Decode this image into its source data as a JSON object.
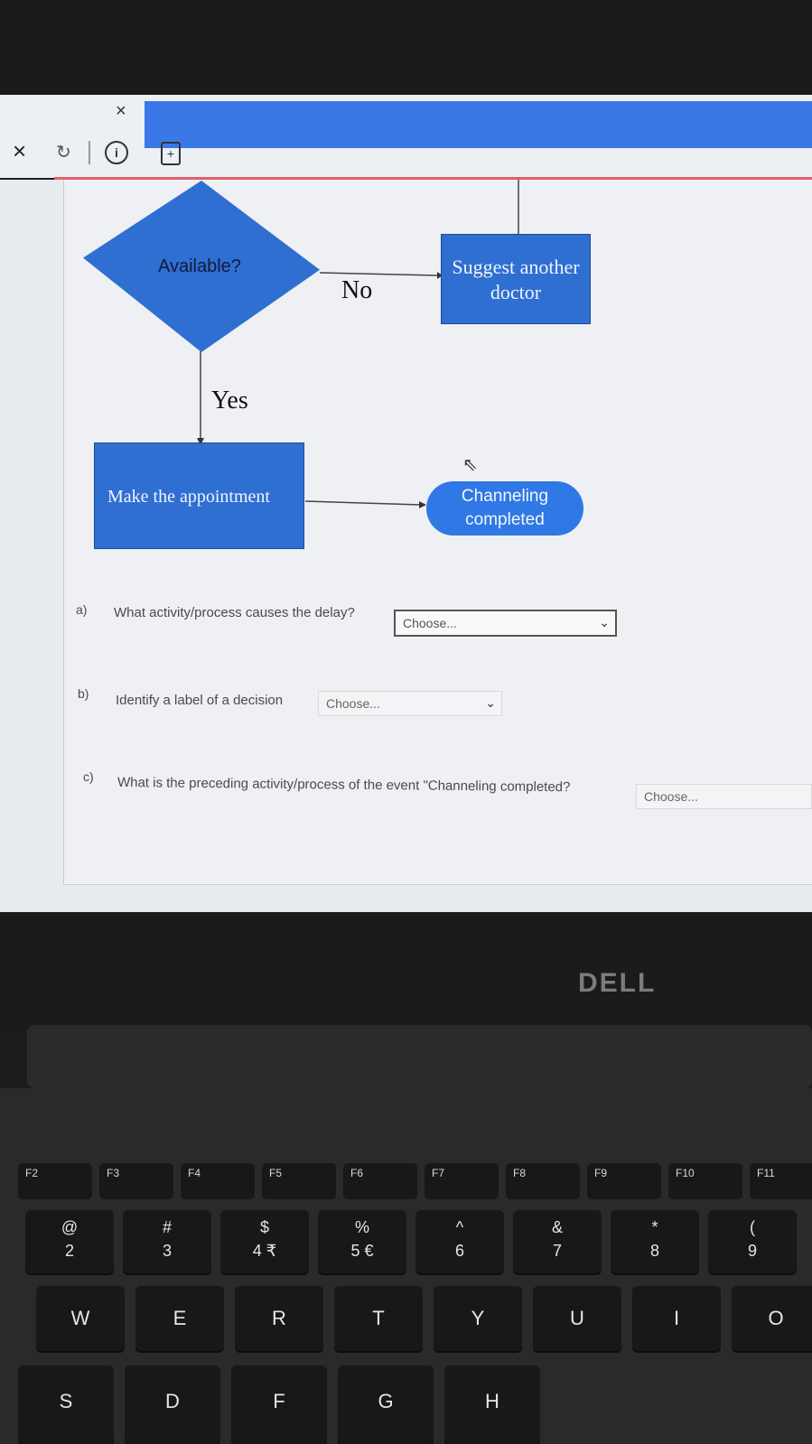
{
  "browser": {
    "tab_close": "×",
    "nav_close": "×",
    "nav_reload": "↻",
    "info_icon": "i",
    "page_icon": "+"
  },
  "flowchart": {
    "decision_label": "Available?",
    "suggest_label_line1": "Suggest another",
    "suggest_label_line2": "doctor",
    "no_label": "No",
    "yes_label": "Yes",
    "make_label": "Make the appointment",
    "end_label_line1": "Channeling",
    "end_label_line2": "completed"
  },
  "questions": {
    "a": {
      "letter": "a)",
      "text": "What activity/process causes the delay?",
      "select_value": "Choose..."
    },
    "b": {
      "letter": "b)",
      "text": "Identify  a label of a decision",
      "select_value": "Choose..."
    },
    "c": {
      "letter": "c)",
      "text": "What is the preceding activity/process of the event \"Channeling completed?",
      "select_value": "Choose..."
    }
  },
  "laptop": {
    "brand": "DELL",
    "fn_keys": [
      "F2",
      "F3",
      "F4",
      "F5",
      "F6",
      "F7",
      "F8",
      "F9",
      "F10",
      "F11"
    ],
    "number_keys": [
      {
        "top": "@",
        "bottom": "2"
      },
      {
        "top": "#",
        "bottom": "3"
      },
      {
        "top": "$",
        "bottom": "4 ₹"
      },
      {
        "top": "%",
        "bottom": "5 €"
      },
      {
        "top": "^",
        "bottom": "6"
      },
      {
        "top": "&",
        "bottom": "7"
      },
      {
        "top": "*",
        "bottom": "8"
      },
      {
        "top": "(",
        "bottom": "9"
      }
    ],
    "letter_row1": [
      "W",
      "E",
      "R",
      "T",
      "Y",
      "U",
      "I",
      "O"
    ],
    "letter_row2": [
      "S",
      "D",
      "F",
      "G",
      "H"
    ]
  },
  "colors": {
    "shape_blue": "#2f6fd1",
    "tab_blue": "#3b78e7",
    "accent_red": "#e0606e"
  }
}
